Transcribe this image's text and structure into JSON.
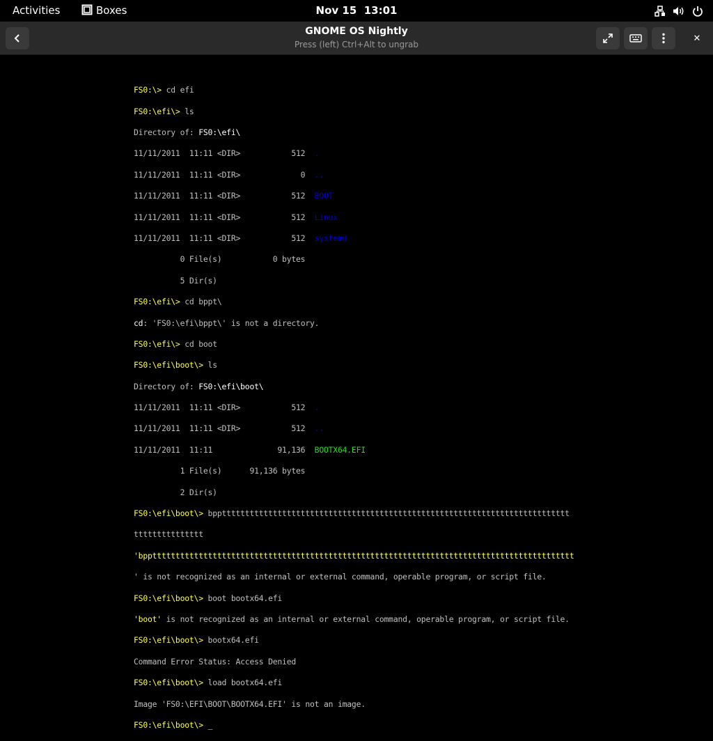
{
  "topbar": {
    "activities": "Activities",
    "app_name": "Boxes",
    "date": "Nov 15",
    "time": "13:01"
  },
  "headerbar": {
    "title": "GNOME OS Nightly",
    "subtitle": "Press (left) Ctrl+Alt to ungrab",
    "close_glyph": "✕"
  },
  "console": {
    "l1": {
      "prompt": "FS0:\\> ",
      "cmd": "cd efi"
    },
    "l2": {
      "prompt": "FS0:\\efi\\> ",
      "cmd": "ls"
    },
    "l3": {
      "label": "Directory of: ",
      "path": "FS0:\\efi\\"
    },
    "l4": {
      "text": "11/11/2011  11:11 <DIR>           512  ",
      "name": "."
    },
    "l5": {
      "text": "11/11/2011  11:11 <DIR>             0  ",
      "name": ".."
    },
    "l6": {
      "text": "11/11/2011  11:11 <DIR>           512  ",
      "name": "BOOT"
    },
    "l7": {
      "text": "11/11/2011  11:11 <DIR>           512  ",
      "name": "Linux"
    },
    "l8": {
      "text": "11/11/2011  11:11 <DIR>           512  ",
      "name": "systemd"
    },
    "l9": {
      "text": "          0 File(s)           0 bytes"
    },
    "l10": {
      "text": "          5 Dir(s)"
    },
    "l11": {
      "prompt": "FS0:\\efi\\> ",
      "cmd": "cd bppt\\"
    },
    "l12": {
      "cmd": "cd",
      "rest": ": 'FS0:\\efi\\bppt\\' is not a directory."
    },
    "l13": {
      "prompt": "FS0:\\efi\\> ",
      "cmd": "cd boot"
    },
    "l14": {
      "prompt": "FS0:\\efi\\boot\\> ",
      "cmd": "ls"
    },
    "l15": {
      "label": "Directory of: ",
      "path": "FS0:\\efi\\boot\\"
    },
    "l16": {
      "text": "11/11/2011  11:11 <DIR>           512  ",
      "name": "."
    },
    "l17": {
      "text": "11/11/2011  11:11 <DIR>           512  ",
      "name": ".."
    },
    "l18": {
      "text": "11/11/2011  11:11              91,136  ",
      "name": "BOOTX64.EFI"
    },
    "l19": {
      "text": "          1 File(s)      91,136 bytes"
    },
    "l20": {
      "text": "          2 Dir(s)"
    },
    "l21": {
      "prompt": "FS0:\\efi\\boot\\> ",
      "cmd": "bppttttttttttttttttttttttttttttttttttttttttttttttttttttttttttttttttttttttttttt"
    },
    "l22": {
      "text": "ttttttttttttttt"
    },
    "l23": {
      "text": "'bppttttttttttttttttttttttttttttttttttttttttttttttttttttttttttttttttttttttttttttttttttttttttttt"
    },
    "l24": {
      "text": "' is not recognized as an internal or external command, operable program, or script file."
    },
    "l25": {
      "prompt": "FS0:\\efi\\boot\\> ",
      "cmd": "boot bootx64.efi"
    },
    "l26": {
      "word": "'boot'",
      "rest": " is not recognized as an internal or external command, operable program, or script file."
    },
    "l27": {
      "prompt": "FS0:\\efi\\boot\\> ",
      "cmd": "bootx64.efi"
    },
    "l28": {
      "text": "Command Error Status: Access Denied"
    },
    "l29": {
      "prompt": "FS0:\\efi\\boot\\> ",
      "cmd": "load bootx64.efi"
    },
    "l30": {
      "text": "Image 'FS0:\\EFI\\BOOT\\BOOTX64.EFI' is not an image."
    },
    "l31": {
      "prompt": "FS0:\\efi\\boot\\> ",
      "cursor": "_"
    }
  },
  "colors": {
    "prompt": "#ffff55",
    "output": "#c0c0c0",
    "directory": "#0000cc",
    "executable": "#22dd22",
    "headerbar": "#2a2a2a"
  }
}
